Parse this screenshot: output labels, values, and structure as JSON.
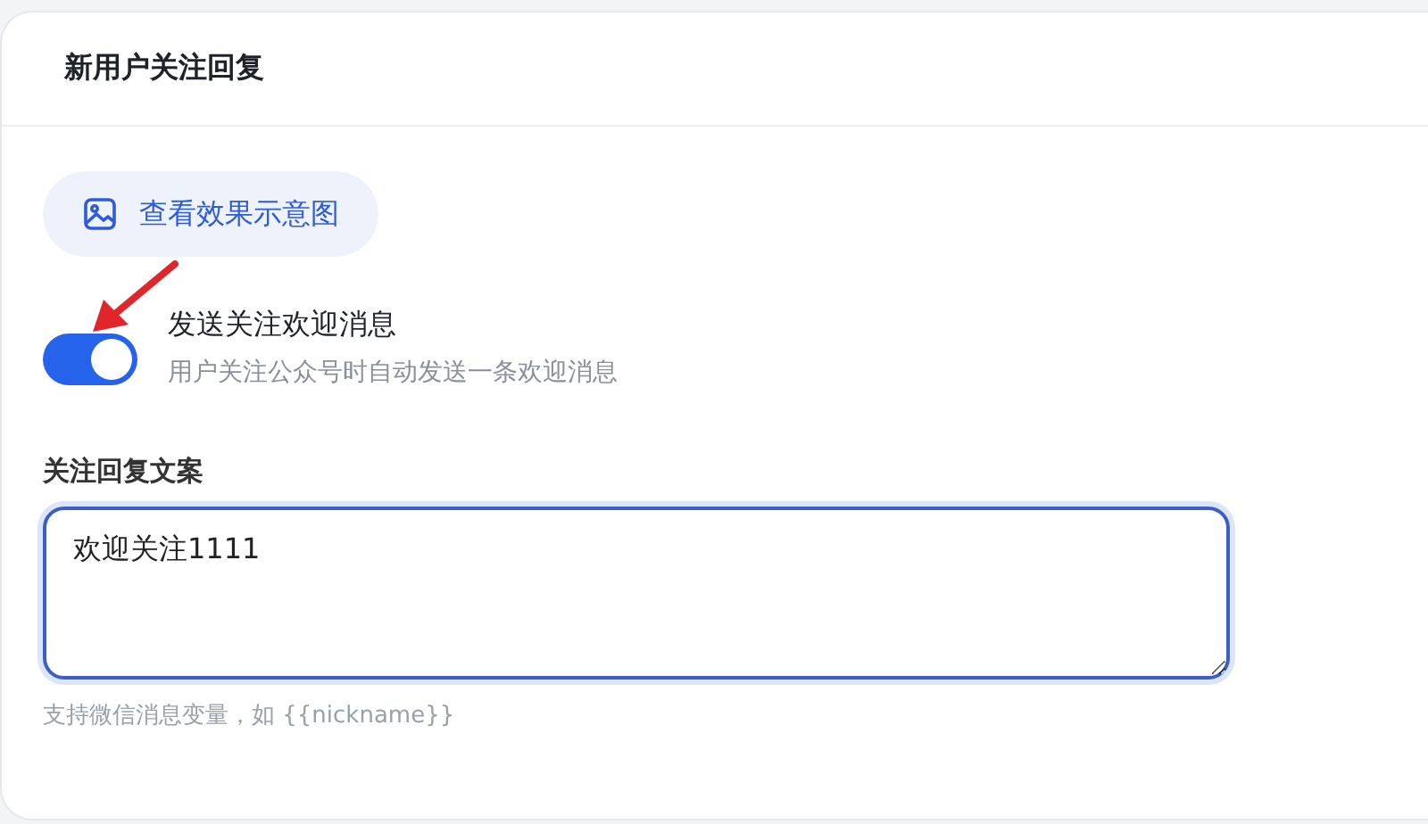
{
  "card": {
    "title": "新用户关注回复"
  },
  "preview_button": {
    "label": "查看效果示意图"
  },
  "welcome_toggle": {
    "on": true,
    "label": "发送关注欢迎消息",
    "description": "用户关注公众号时自动发送一条欢迎消息"
  },
  "reply_field": {
    "label": "关注回复文案",
    "value": "欢迎关注1111",
    "hint": "支持微信消息变量，如 {{nickname}}"
  }
}
